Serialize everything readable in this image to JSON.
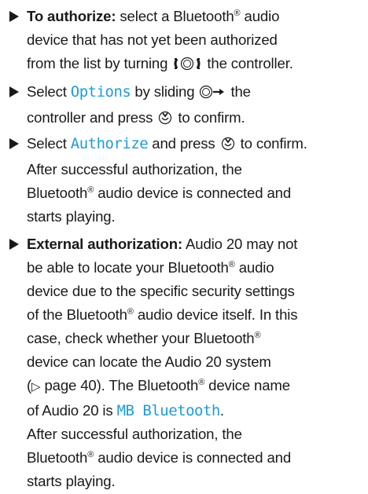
{
  "steps": [
    {
      "lines": [
        {
          "prefix_bold": "To authorize:",
          "text": " select a Bluetooth",
          "reg": "®",
          "text2": " audio"
        },
        {
          "text": "device that has not yet been authorized"
        },
        {
          "text": "from the list by turning ",
          "icon": "controller-turn-icon",
          "text2": " the controller."
        }
      ]
    },
    {
      "l1_a": "Select ",
      "l1_disp": "Options",
      "l1_b": " by sliding ",
      "l1_c": " the",
      "l2_a": "controller and press ",
      "l2_b": " to confirm."
    },
    {
      "l1_a": "Select ",
      "l1_disp": "Authorize",
      "l1_b": " and press ",
      "l1_c": " to confirm.",
      "l2": "After successful authorization, the",
      "l3_a": "Bluetooth",
      "l3_reg": "®",
      "l3_b": " audio device is connected and",
      "l4": "starts playing."
    },
    {
      "l1_bold": "External authorization:",
      "l1_b": " Audio 20 may not",
      "l2": "be able to locate your Bluetooth",
      "l2_reg": "®",
      "l2_b": " audio",
      "l3": "device due to the specific security settings",
      "l4_a": "of the Bluetooth",
      "l4_reg": "®",
      "l4_b": " audio device itself. In this",
      "l5_a": "case, check whether your Bluetooth",
      "l5_reg": "®",
      "l6": "device can locate the Audio 20 system",
      "l7_a": "(",
      "l7_arrow": "▷",
      "l7_b": " page 40). The Bluetooth",
      "l7_reg": "®",
      "l7_c": " device name",
      "l8_a": "of Audio 20 is ",
      "l8_disp": "MB Bluetooth",
      "l8_b": ".",
      "l9": "After successful authorization, the",
      "l10_a": "Bluetooth",
      "l10_reg": "®",
      "l10_b": " audio device is connected and",
      "l11": "starts playing."
    }
  ],
  "colors": {
    "display_text": "#1e9cd7",
    "body_text": "#1a1a1a"
  }
}
